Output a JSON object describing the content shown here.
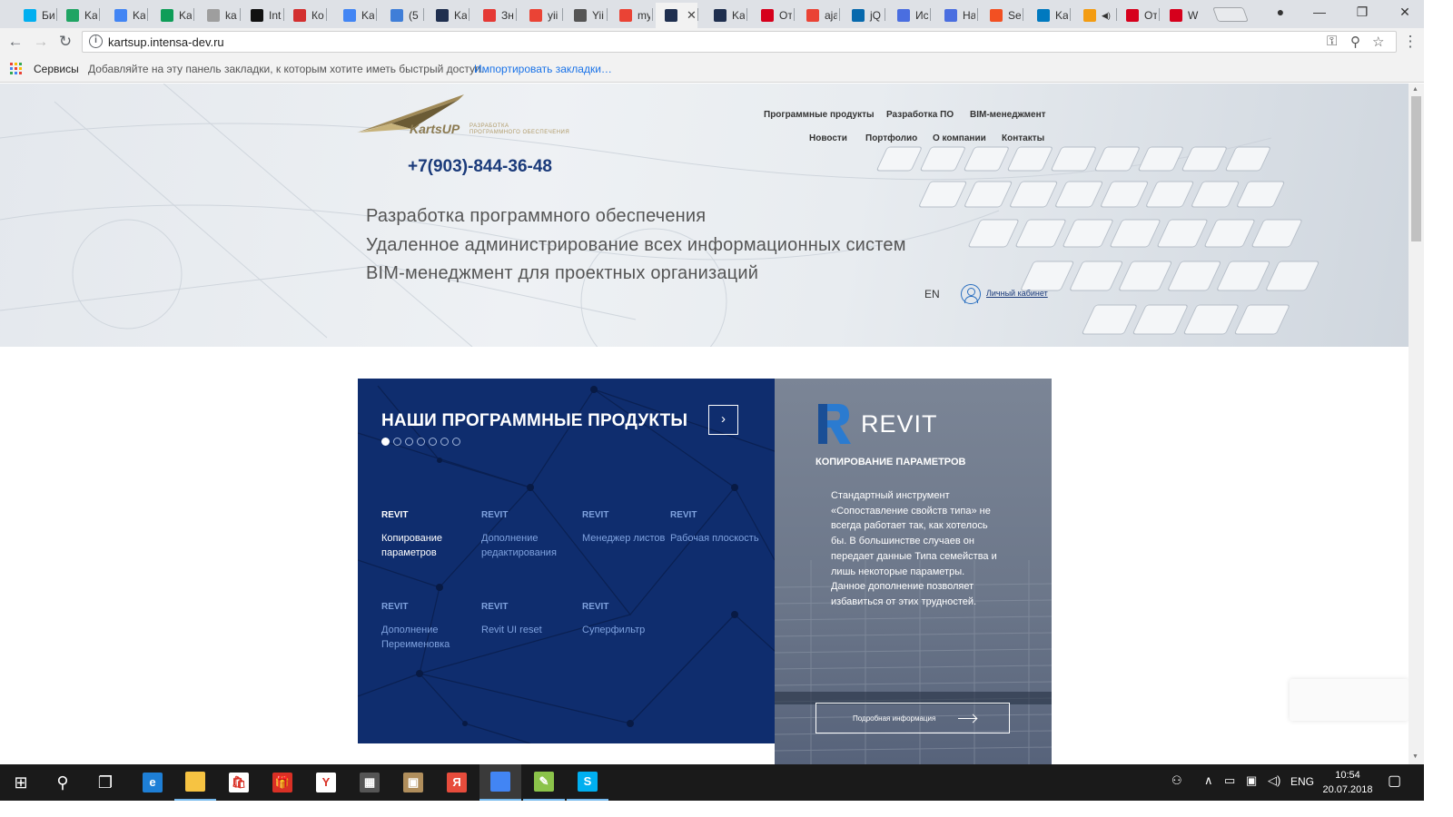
{
  "browser": {
    "tabs": [
      {
        "label": "Би",
        "icon": "skype",
        "color": "#00aff0"
      },
      {
        "label": "Ka",
        "icon": "google-drive",
        "color": "#1fa463"
      },
      {
        "label": "Ka",
        "icon": "google-docs",
        "color": "#4285f4"
      },
      {
        "label": "Ka",
        "icon": "google-sheets",
        "color": "#0f9d58"
      },
      {
        "label": "ka",
        "icon": "page",
        "color": "#9e9e9e"
      },
      {
        "label": "Int",
        "icon": "intensa",
        "color": "#111111"
      },
      {
        "label": "Ко",
        "icon": "brand-red",
        "color": "#d32f2f"
      },
      {
        "label": "Ka",
        "icon": "google-docs",
        "color": "#4285f4"
      },
      {
        "label": "(5",
        "icon": "mail",
        "color": "#3f7ed8"
      },
      {
        "label": "Ka",
        "icon": "kartsup",
        "color": "#1f2f4f"
      },
      {
        "label": "Зн",
        "icon": "heart",
        "color": "#e53935"
      },
      {
        "label": "yii",
        "icon": "google",
        "color": "#ea4335"
      },
      {
        "label": "Yii",
        "icon": "code",
        "color": "#555555"
      },
      {
        "label": "my",
        "icon": "google",
        "color": "#ea4335"
      },
      {
        "label": "",
        "icon": "kartsup",
        "color": "#1f2f4f",
        "active": true
      },
      {
        "label": "Ka",
        "icon": "kartsup",
        "color": "#1f2f4f"
      },
      {
        "label": "От",
        "icon": "hh",
        "color": "#d6001c"
      },
      {
        "label": "aja",
        "icon": "google",
        "color": "#ea4335"
      },
      {
        "label": "jQ",
        "icon": "jquery",
        "color": "#0769ad"
      },
      {
        "label": "Ис",
        "icon": "history",
        "color": "#4a6ee0"
      },
      {
        "label": "На",
        "icon": "settings",
        "color": "#4a6ee0"
      },
      {
        "label": "Se",
        "icon": "microsoft",
        "color": "#f25022"
      },
      {
        "label": "Ka",
        "icon": "trello",
        "color": "#0079bf"
      },
      {
        "label": "",
        "icon": "music",
        "color": "#f39c12",
        "audio": true
      },
      {
        "label": "От",
        "icon": "hh",
        "color": "#d6001c"
      },
      {
        "label": "W",
        "icon": "hh",
        "color": "#d6001c"
      }
    ],
    "close_glyph": "✕",
    "url": "kartsup.intensa-dev.ru",
    "bookmarks": {
      "services": "Сервисы",
      "prompt": "Добавляйте на эту панель закладки, к которым хотите иметь быстрый доступ.",
      "import": "Импортировать закладки…"
    }
  },
  "site": {
    "logo": {
      "name": "KartsUP",
      "sub1": "РАЗРАБОТКА",
      "sub2": "ПРОГРАММНОГО ОБЕСПЕЧЕНИЯ"
    },
    "phone": "+7(903)-844-36-48",
    "nav_top": [
      "Программные продукты",
      "Разработка ПО",
      "BIM-менеджмент"
    ],
    "nav_bottom": [
      "Новости",
      "Портфолио",
      "О компании",
      "Контакты"
    ],
    "taglines": [
      "Разработка программного обеспечения",
      "Удаленное администрирование всех информационных систем",
      "BIM-менеджмент для проектных организаций"
    ],
    "lang": "EN",
    "cabinet": "Личный кабинет",
    "products": {
      "title": "НАШИ ПРОГРАММНЫЕ ПРОДУКТЫ",
      "next": "›",
      "items": [
        {
          "category": "REVIT",
          "name": "Копирование параметров",
          "active": true
        },
        {
          "category": "REVIT",
          "name": "Дополнение редактирования"
        },
        {
          "category": "REVIT",
          "name": "Менеджер листов"
        },
        {
          "category": "REVIT",
          "name": "Рабочая плоскость"
        },
        {
          "category": "REVIT",
          "name": "Дополнение Переименовка"
        },
        {
          "category": "REVIT",
          "name": "Revit UI reset"
        },
        {
          "category": "REVIT",
          "name": "Суперфильтр"
        }
      ]
    },
    "detail": {
      "brand": "REVIT",
      "title": "КОПИРОВАНИЕ ПАРАМЕТРОВ",
      "description": "Стандартный инструмент «Сопоставление свойств типа» не всегда работает так, как хотелось бы. В большинстве случаев он передает данные Типа семейства и лишь некоторые параметры. Данное дополнение позволяет избавиться от этих трудностей.",
      "button": "Подробная информация"
    }
  },
  "taskbar": {
    "apps": [
      {
        "name": "start",
        "glyph": "⊞"
      },
      {
        "name": "search",
        "glyph": "⚲"
      },
      {
        "name": "task-view",
        "glyph": "❐"
      },
      {
        "name": "edge",
        "glyph": "e",
        "color": "#1e7fd6"
      },
      {
        "name": "file-explorer",
        "glyph": "",
        "color": "#f6c342",
        "running": true
      },
      {
        "name": "store",
        "glyph": "🛍",
        "color": "#ffffff"
      },
      {
        "name": "gift",
        "glyph": "🎁",
        "color": "#d93025"
      },
      {
        "name": "yandex",
        "glyph": "Y",
        "color": "#ffffff"
      },
      {
        "name": "calculator",
        "glyph": "▦",
        "color": "#555555"
      },
      {
        "name": "archive",
        "glyph": "▣",
        "color": "#b08e5c"
      },
      {
        "name": "yandex-browser",
        "glyph": "Я",
        "color": "#e74c3c"
      },
      {
        "name": "chrome",
        "glyph": "",
        "color": "#4285f4",
        "current": true
      },
      {
        "name": "notepad",
        "glyph": "✎",
        "color": "#8bc34a",
        "running": true
      },
      {
        "name": "skype",
        "glyph": "S",
        "color": "#00aff0",
        "running": true
      }
    ],
    "language": "ENG",
    "time": "10:54",
    "date": "20.07.2018"
  }
}
